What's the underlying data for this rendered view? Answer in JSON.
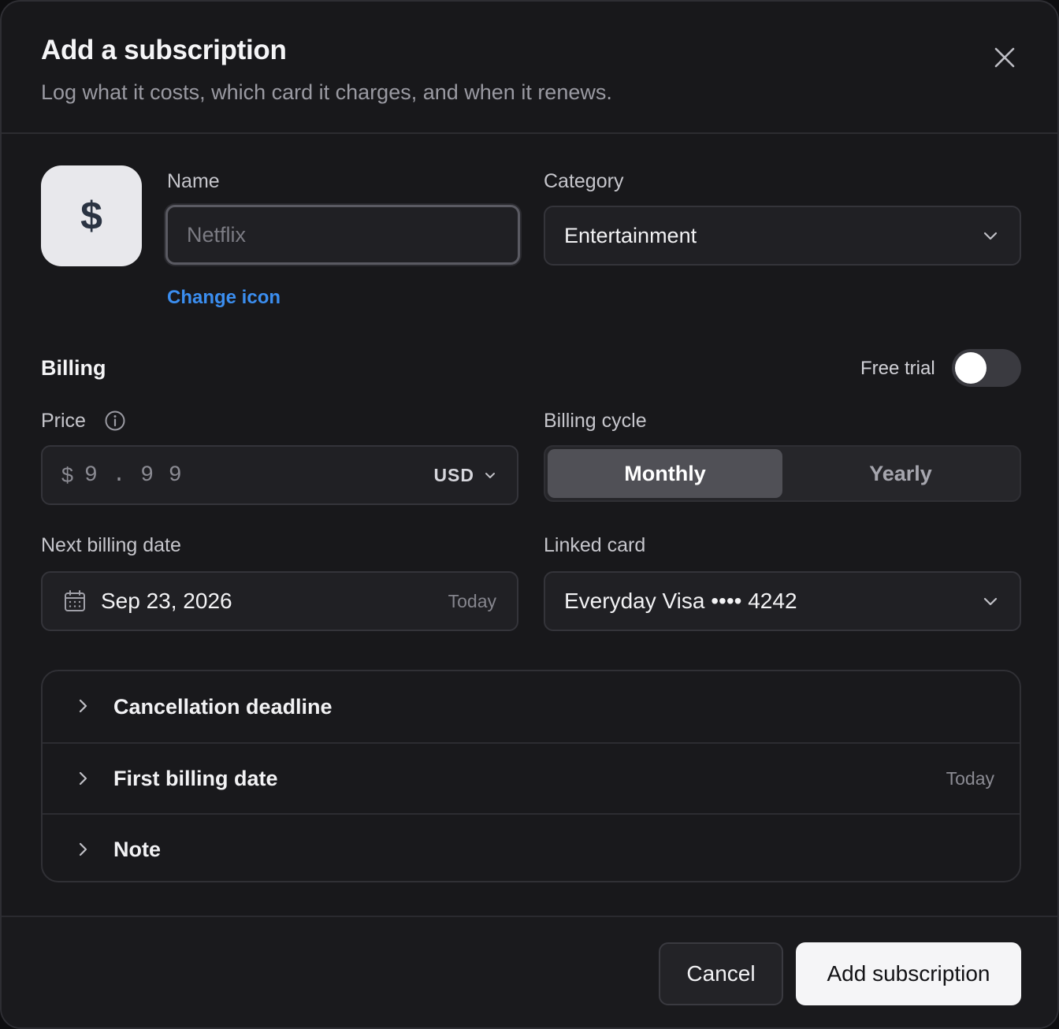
{
  "dialog": {
    "title": "Add a subscription",
    "subtitle": "Log what it costs, which card it charges, and when it renews.",
    "close_icon": "close-icon"
  },
  "icon_tile": {
    "glyph": "$",
    "icon": "dollar-icon"
  },
  "name": {
    "label": "Name",
    "placeholder": "Netflix",
    "value": ""
  },
  "change_icon_label": "Change icon",
  "category": {
    "label": "Category",
    "value": "Entertainment",
    "icon": "chevron-down-icon"
  },
  "billing": {
    "title": "Billing",
    "free_trial_label": "Free trial",
    "free_trial_on": false,
    "price": {
      "label": "Price",
      "info_icon": "info-icon",
      "currency_symbol": "$",
      "placeholder": "9.99",
      "currency": "USD"
    },
    "cycle": {
      "label": "Billing cycle",
      "options": [
        "Monthly",
        "Yearly"
      ],
      "selected": "Monthly"
    },
    "next_date": {
      "label": "Next billing date",
      "value": "Sep 23, 2026",
      "hint": "Today",
      "icon": "calendar-icon"
    },
    "card": {
      "label": "Linked card",
      "value": "Everyday Visa •••• 4242"
    }
  },
  "expanders": [
    {
      "label": "Cancellation deadline",
      "right": ""
    },
    {
      "label": "First billing date",
      "right": "Today"
    },
    {
      "label": "Note",
      "right": ""
    }
  ],
  "footer": {
    "cancel_label": "Cancel",
    "submit_label": "Add subscription"
  },
  "colors": {
    "accent_link": "#3b8ef0",
    "surface": "#18181b",
    "primary_button": "#f5f5f7"
  }
}
